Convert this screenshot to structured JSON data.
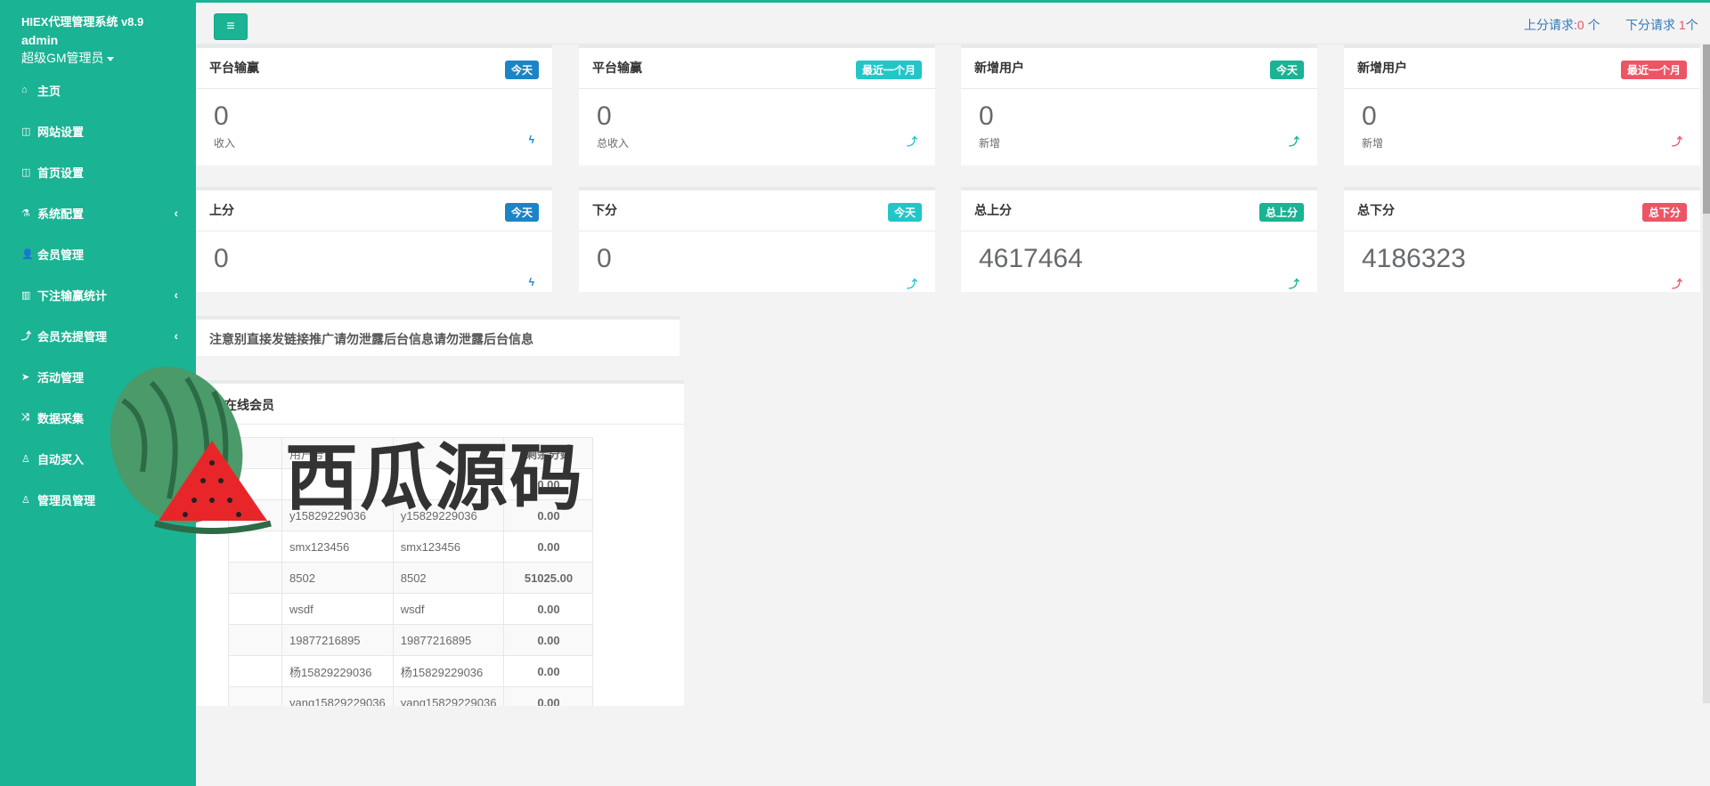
{
  "sidebar": {
    "brand": "HIEX代理管理系统 v8.9",
    "username": "admin",
    "role": "超级GM管理员",
    "items": [
      {
        "label": "主页",
        "icon": "home-icon",
        "glyph": "⌂",
        "arrow": ""
      },
      {
        "label": "网站设置",
        "icon": "columns-icon",
        "glyph": "◫",
        "arrow": ""
      },
      {
        "label": "首页设置",
        "icon": "columns-icon",
        "glyph": "◫",
        "arrow": ""
      },
      {
        "label": "系统配置",
        "icon": "flask-icon",
        "glyph": "⚗",
        "arrow": "‹"
      },
      {
        "label": "会员管理",
        "icon": "user-icon",
        "glyph": "👤",
        "arrow": ""
      },
      {
        "label": "下注输赢统计",
        "icon": "bar-chart-icon",
        "glyph": "▥",
        "arrow": "‹"
      },
      {
        "label": "会员充提管理",
        "icon": "level-up-icon",
        "glyph": "⤴",
        "arrow": "‹"
      },
      {
        "label": "活动管理",
        "icon": "paper-plane-icon",
        "glyph": "➤",
        "arrow": ""
      },
      {
        "label": "数据采集",
        "icon": "random-icon",
        "glyph": "⤨",
        "arrow": ""
      },
      {
        "label": "自动买入",
        "icon": "male-icon",
        "glyph": "♙",
        "arrow": ""
      },
      {
        "label": "管理员管理",
        "icon": "male-icon",
        "glyph": "♙",
        "arrow": ""
      }
    ]
  },
  "topbar": {
    "menu_icon": "≡",
    "up_label": "上分请求:",
    "up_count": "0",
    "up_unit": " 个",
    "down_label": "下分请求 ",
    "down_count": "1",
    "down_unit": "个"
  },
  "stats_row1": [
    {
      "title": "平台输赢",
      "badge": "今天",
      "value": "0",
      "sub": "收入",
      "icon": "bolt-icon",
      "glyph": "ϟ",
      "badge_color": "#1c84c6",
      "icon_color": "#1c84c6"
    },
    {
      "title": "平台输赢",
      "badge": "最近一个月",
      "value": "0",
      "sub": "总收入",
      "icon": "level-up-icon",
      "glyph": "⤴",
      "badge_color": "#23c6c8",
      "icon_color": "#23c6c8"
    },
    {
      "title": "新增用户",
      "badge": "今天",
      "value": "0",
      "sub": "新增",
      "icon": "level-up-icon",
      "glyph": "⤴",
      "badge_color": "#1ab394",
      "icon_color": "#1ab394"
    },
    {
      "title": "新增用户",
      "badge": "最近一个月",
      "value": "0",
      "sub": "新增",
      "icon": "level-up-icon",
      "glyph": "⤴",
      "badge_color": "#ed5565",
      "icon_color": "#ed5565"
    }
  ],
  "stats_row2": [
    {
      "title": "上分",
      "badge": "今天",
      "value": "0",
      "icon": "bolt-icon",
      "glyph": "ϟ",
      "badge_color": "#1c84c6",
      "icon_color": "#1c84c6"
    },
    {
      "title": "下分",
      "badge": "今天",
      "value": "0",
      "icon": "level-up-icon",
      "glyph": "⤴",
      "badge_color": "#23c6c8",
      "icon_color": "#23c6c8"
    },
    {
      "title": "总上分",
      "badge": "总上分",
      "value": "4617464",
      "icon": "level-up-icon",
      "glyph": "⤴",
      "badge_color": "#1ab394",
      "icon_color": "#1ab394"
    },
    {
      "title": "总下分",
      "badge": "总下分",
      "value": "4186323",
      "icon": "level-up-icon",
      "glyph": "⤴",
      "badge_color": "#ed5565",
      "icon_color": "#ed5565"
    }
  ],
  "notice": "注意别直接发链接推广请勿泄露后台信息请勿泄露后台信息",
  "online": {
    "title": "在线会员",
    "headers": [
      "",
      "用户号",
      "",
      "剩余分数"
    ],
    "rows": [
      [
        "",
        "",
        "",
        "0.00"
      ],
      [
        "",
        "y15829229036",
        "y15829229036",
        "0.00"
      ],
      [
        "",
        "smx123456",
        "smx123456",
        "0.00"
      ],
      [
        "",
        "8502",
        "8502",
        "51025.00"
      ],
      [
        "",
        "wsdf",
        "wsdf",
        "0.00"
      ],
      [
        "",
        "19877216895",
        "19877216895",
        "0.00"
      ],
      [
        "",
        "杨15829229036",
        "杨15829229036",
        "0.00"
      ],
      [
        "",
        "yang15829229036",
        "yang15829229036",
        "0.00"
      ]
    ]
  },
  "watermark": {
    "text": "西瓜源码"
  },
  "colors": {
    "accent": "#1ab394",
    "primary": "#1c84c6",
    "info": "#23c6c8",
    "danger": "#ed5565"
  }
}
